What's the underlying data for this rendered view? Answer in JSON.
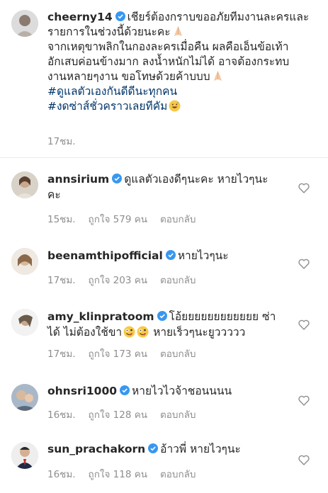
{
  "caption": {
    "username": "cheerny14",
    "lines": [
      "เชียร์ต้องกราบขออภัยทีมงานละครและ",
      "รายการในช่วงนี้ด้วยนะคะ",
      "จากเหตุขาพลิกในกองละครเมื่อคืน ผลคือเอ็นข้อเท้า",
      "อักเสบค่อนข้างมาก ลงน้ำหนักไม่ได้ อาจต้องกระทบ",
      "งานหลายๆงาน ขอโทษด้วยค้าบบบ"
    ],
    "hashtags": [
      "#ดูแลตัวเองกันดีดีนะทุกคน",
      "#งดซ่าส์ชั่วคราวเลยทีคัม"
    ],
    "time": "17ชม."
  },
  "comments": [
    {
      "username": "annsirium",
      "line1": "ดูแลตัวเองดีๆนะคะ หายไวๆนะ",
      "line2": "คะ",
      "time": "15ชม.",
      "likes": "ถูกใจ 579 คน",
      "reply": "ตอบกลับ"
    },
    {
      "username": "beenamthipofficial",
      "line1": "หายไวๆนะ",
      "line2": "",
      "time": "17ชม.",
      "likes": "ถูกใจ 203 คน",
      "reply": "ตอบกลับ"
    },
    {
      "username": "amy_klinpratoom",
      "line1": "โอ้ยยยยยยยยยยยย ซ่า",
      "line2": "ได้ ไม่ต้องใช้ขา",
      "line2b": "หายเร็วๆนะยูววววว",
      "time": "17ชม.",
      "likes": "ถูกใจ 173 คน",
      "reply": "ตอบกลับ"
    },
    {
      "username": "ohnsri1000",
      "line1": "หายไวไวจ้าชอนนนน",
      "line2": "",
      "time": "16ชม.",
      "likes": "ถูกใจ 128 คน",
      "reply": "ตอบกลับ"
    },
    {
      "username": "sun_prachakorn",
      "line1": "อ้าวพี่ หายไวๆนะ",
      "line2": "",
      "time": "16ชม.",
      "likes": "ถูกใจ 118 คน",
      "reply": "ตอบกลับ"
    }
  ],
  "colors": {
    "verified": "#3897f0",
    "hashtag": "#003569",
    "meta": "#8e8e8e"
  },
  "icons": {
    "verified": "verified-badge-icon",
    "like": "heart-outline-icon",
    "praying": "folded-hands-emoji",
    "grinning_sweat": "grinning-sweat-emoji",
    "zany": "zany-face-emoji"
  }
}
